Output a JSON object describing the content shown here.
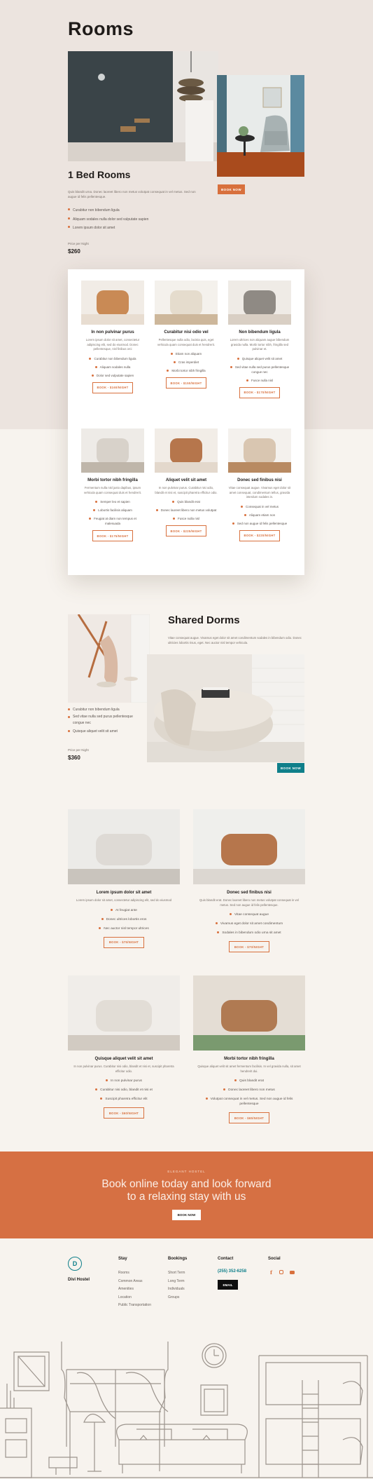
{
  "rooms": {
    "title": "Rooms",
    "one_bed": {
      "title": "1 Bed Rooms",
      "desc": "Quis blandit urna. Donec laoreet libero non metus volutpat consequat in vel metus. Sed non augue id felis pellentesque.",
      "features": [
        "Curabitur non bibendum ligula",
        "Aliquam sodales nulla dolor sed vulputate sapien",
        "Lorem ipsum dolor sit amet"
      ],
      "price_label": "Price per Night",
      "price": "$260",
      "button": "BOOK NOW"
    },
    "cards": [
      {
        "title": "In non pulvinar purus",
        "desc": "Lorem ipsum dolor sit amet, consectetur adipiscing elit, sed do eiusmod. Donec pellentesque, nisl finibus orci",
        "features": [
          "Curabitur non bibendum ligula",
          "Aliquam sodales nulla",
          "Dolor sed vulputate sapien"
        ],
        "button": "BOOK - $160/NIGHT"
      },
      {
        "title": "Curabitur nisi odio vel",
        "desc": "Pellentesque nulla odio, lacinia quis, eget vehicula quam consequat duis et hendrerit.",
        "features": [
          "Etiam non aliquam",
          "Cras imperdiet",
          "Morbi tortor nibh fringilla"
        ],
        "button": "BOOK - $150/NIGHT"
      },
      {
        "title": "Non bibendum ligula",
        "desc": "Lorem ultrices non aliquam augue bibendum gravida nulla. Morbi tortor nibh, fringilla sed pulvinar et.",
        "features": [
          "Quisque aliquet velit sit amet",
          "Sed vitae nulla sed purus pellentesque congue nec",
          "Fusce nulla nisl"
        ],
        "button": "BOOK - $170/NIGHT"
      },
      {
        "title": "Morbi tortor nibh fringilla",
        "desc": "Fermentum nulla nisl justo dapibus, ipsum vehicula quam consequat duis et hendrerit.",
        "features": [
          "Semper leo et sapien",
          "Lobortis facilisis aliquam",
          "Feugiat at diam non tempus et malesuada"
        ],
        "button": "BOOK - $175/NIGHT"
      },
      {
        "title": "Aliquet velit sit amet",
        "desc": "In non pulvinar purus. Curabitur nisi odio, blandit et nisi et, suscipit pharetra efficitur odio.",
        "features": [
          "Quis blandit erat",
          "Donec laoreet libero non metus volutpat",
          "Fusce nulla nisl"
        ],
        "button": "BOOK - $225/NIGHT"
      },
      {
        "title": "Donec sed finibus nisi",
        "desc": "Vitae consequat augue. Vivamus eget dolor sit amet consequat, condimentum tellus, gravida interdum sodales in.",
        "features": [
          "Consequat in vel metus",
          "Aliquam etiam non",
          "Sed non augue id felis pellentesque"
        ],
        "button": "BOOK - $220/NIGHT"
      }
    ]
  },
  "dorms": {
    "title": "Shared Dorms",
    "desc": "Vitae consequat augue. Vivamus eget dolor sit amet condimentum sodales in bibendum odio. Donec ultricies lobortis risus, eget. Nec auctor nisl tempor vehicula.",
    "features": [
      "Curabitur non bibendum ligula",
      "Sed vitae nulla sed purus pellentesque congue nec",
      "Quisque aliquet velit sit amet"
    ],
    "price_label": "Price per Night",
    "price": "$360",
    "button": "BOOK NOW",
    "cards": [
      {
        "title": "Lorem ipsum dolor sit amet",
        "desc": "Lorem ipsum dolor sit amet, consectetur adipiscing elit, sed do eiusmod",
        "features": [
          "At feugiat ante",
          "Donec ultrices lobortis eros",
          "Nec auctor nisl tempor ultrices"
        ],
        "button": "BOOK - $75/NIGHT"
      },
      {
        "title": "Donec sed finibus nisi",
        "desc": "Quis blandit erat. Donec laoreet libero non metus volutpat consequat in vel metus. Sed non augue id felis pellentesque.",
        "features": [
          "Vitae consequat augue",
          "Vivamus eget dolor sit amet condimentum",
          "Sodales in bibendum odio urna sit amet"
        ],
        "button": "BOOK - $70/NIGHT"
      },
      {
        "title": "Quisque aliquet velit sit amet",
        "desc": "In non pulvinar purus. Curabitur nisi odio, blandit et nisi et, suscipit pharetra efficitur odio.",
        "features": [
          "In non pulvinar purus",
          "Curabitur nisi odio, blandit et nisi et",
          "Suscipit pharetra efficitur elit"
        ],
        "button": "BOOK - $60/NIGHT"
      },
      {
        "title": "Morbi tortor nibh fringilla",
        "desc": "Quisque aliquet velit sit amet fermentum facilisis. In vel gravida nulla, sit amet hendrerit dui.",
        "features": [
          "Quis blandit erat",
          "Donec laoreet libero non metus",
          "Volutpat consequat in vel metus. Sed non augue id felis pellentesque"
        ],
        "button": "BOOK - $65/NIGHT"
      }
    ]
  },
  "cta": {
    "eyebrow": "ELEGANT HOSTEL",
    "heading_line1": "Book online today and look forward",
    "heading_line2": "to a relaxing stay with us",
    "button": "BOOK NOW"
  },
  "footer": {
    "logo_letter": "D",
    "brand": "Divi Hostel",
    "stay": {
      "title": "Stay",
      "items": [
        "Rooms",
        "Common Areas",
        "Amenities",
        "Location",
        "Public Transportation"
      ]
    },
    "bookings": {
      "title": "Bookings",
      "items": [
        "Short Term",
        "Long Term",
        "Individuals",
        "Groups"
      ]
    },
    "contact": {
      "title": "Contact",
      "phone": "(255) 352-6258",
      "email_button": "EMAIL"
    },
    "social": {
      "title": "Social",
      "icons": [
        "facebook-icon",
        "instagram-icon",
        "youtube-icon"
      ]
    }
  },
  "colors": {
    "accent": "#d8703d",
    "teal": "#0f7f8a",
    "cta_bg": "#d67043"
  }
}
